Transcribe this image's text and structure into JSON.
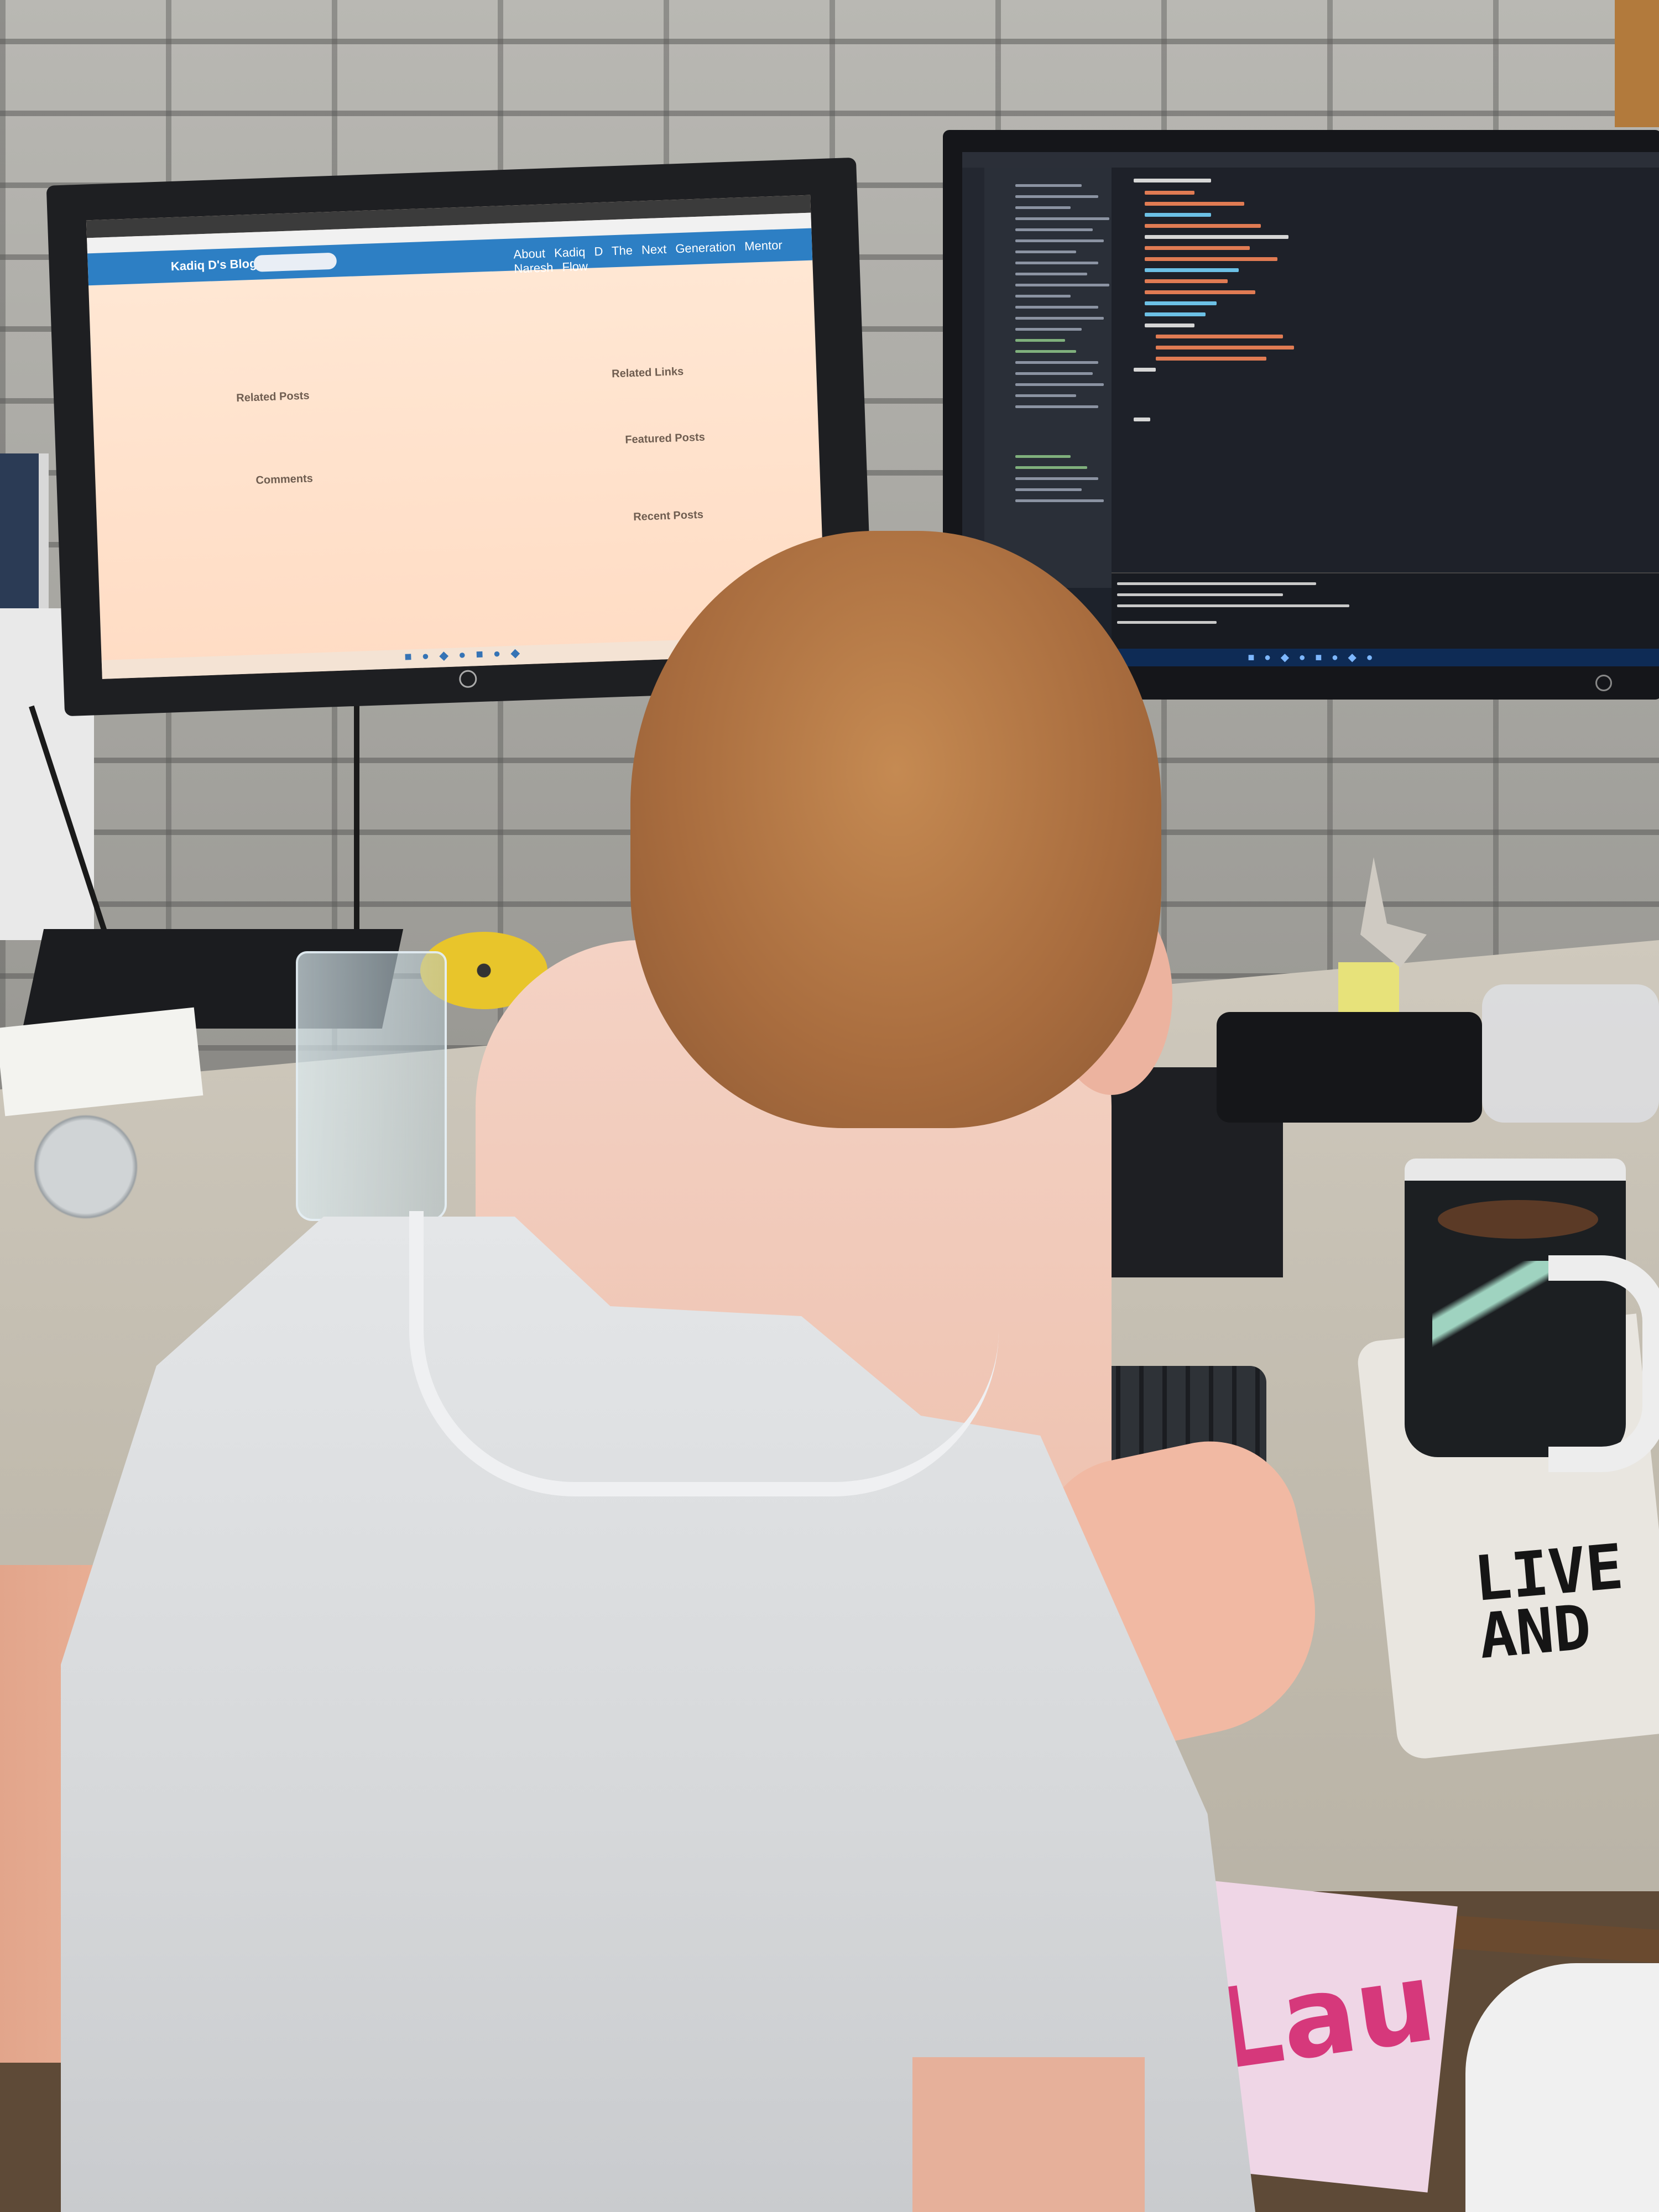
{
  "scene": {
    "description_tags": [
      "photo",
      "child",
      "desk",
      "two-monitors",
      "keyboard",
      "mug"
    ]
  },
  "left_monitor": {
    "brand_logo": "hp-logo-icon",
    "browser": {
      "nav_brand": "Kadiq D's Blog",
      "nav_menu": "About   Kadiq D The Next Generation   Mentor   Naresh Flow"
    },
    "blog": {
      "related_posts_heading": "Related Posts",
      "comments_heading": "Comments",
      "related_links_heading": "Related Links",
      "featured_posts_heading": "Featured Posts",
      "recent_posts_heading": "Recent Posts"
    }
  },
  "right_monitor": {
    "brand_logo": "hp-logo-icon",
    "app": "code-editor"
  },
  "mousepad": {
    "line1": "LIVE",
    "line2": "AND"
  },
  "book": {
    "visible_text": "Lau"
  },
  "colors": {
    "browser_nav": "#2d7fc4",
    "editor_bg": "#1e2129",
    "wall": "#b1b0ab",
    "shirt": "#dcdee0",
    "hair": "#b77c48",
    "book_text": "#d6387b",
    "cd": "#e8c52b"
  }
}
